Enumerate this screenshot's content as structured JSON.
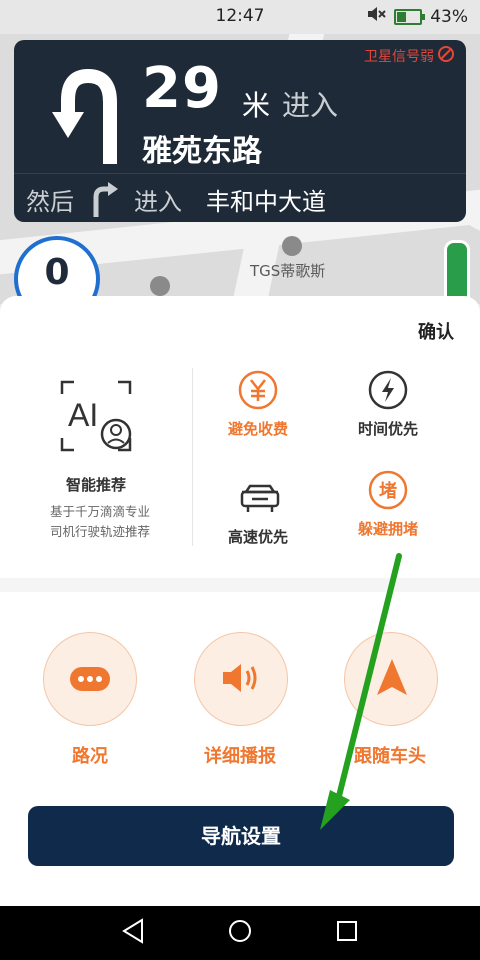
{
  "status": {
    "time": "12:47",
    "battery": "43%",
    "battery_level": 0.43
  },
  "nav_card": {
    "distance": "29",
    "unit": "米",
    "enter": "进入",
    "street": "雅苑东路",
    "gps_warning": "卫星信号弱",
    "then": "然后",
    "then_enter": "进入",
    "then_street": "丰和中大道"
  },
  "map": {
    "speed": "0",
    "poi_name": "TGS蒂歌斯"
  },
  "sheet": {
    "confirm": "确认",
    "ai_icon_text": "AI",
    "ai_title": "智能推荐",
    "ai_desc_line1": "基于千万滴滴专业",
    "ai_desc_line2": "司机行驶轨迹推荐",
    "options": [
      {
        "label": "避免收费",
        "icon": "yen-icon",
        "selected": true
      },
      {
        "label": "时间优先",
        "icon": "clock-bolt-icon",
        "selected": false
      },
      {
        "label": "高速优先",
        "icon": "highway-car-icon",
        "selected": false
      },
      {
        "label": "躲避拥堵",
        "icon": "congestion-icon",
        "icon_text": "堵",
        "selected": true
      }
    ],
    "modes": [
      {
        "label": "路况",
        "icon": "traffic-dots-icon"
      },
      {
        "label": "详细播报",
        "icon": "speaker-icon"
      },
      {
        "label": "跟随车头",
        "icon": "navigation-arrow-icon"
      }
    ],
    "nav_settings_label": "导航设置"
  },
  "colors": {
    "accent": "#f0772f",
    "nav_dark": "#1e2a37",
    "button_dark": "#0f2a4b",
    "speed_ring": "#1f6fd1",
    "gps_red": "#e3473a"
  }
}
